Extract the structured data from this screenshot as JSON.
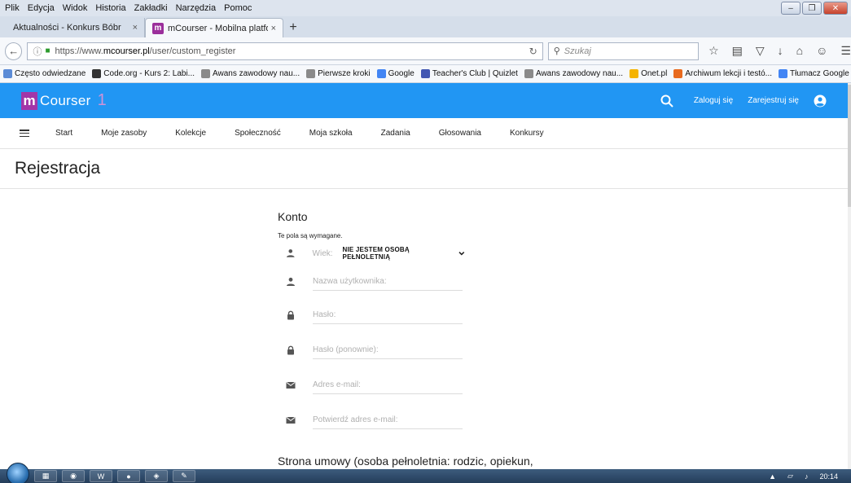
{
  "browser": {
    "menu": [
      "Plik",
      "Edycja",
      "Widok",
      "Historia",
      "Zakładki",
      "Narzędzia",
      "Pomoc"
    ],
    "tabs": [
      {
        "label": "Aktualności - Konkurs Bóbr",
        "close": "×"
      },
      {
        "label": "mCourser - Mobilna platfo...",
        "close": "×",
        "favicon": "m"
      }
    ],
    "new_tab": "+",
    "url_prefix": "https://www.",
    "url_domain": "mcourser.pl",
    "url_path": "/user/custom_register",
    "search_placeholder": "Szukaj",
    "bookmarks": [
      {
        "label": "Często odwiedzane",
        "color": "#5b8bd6"
      },
      {
        "label": "Code.org - Kurs 2: Labi...",
        "color": "#333333"
      },
      {
        "label": "Awans zawodowy nau...",
        "color": "#8a8a8a"
      },
      {
        "label": "Pierwsze kroki",
        "color": "#8a8a8a"
      },
      {
        "label": "Google",
        "color": "#4285f4"
      },
      {
        "label": "Teacher's Club | Quizlet",
        "color": "#4257b2"
      },
      {
        "label": "Awans zawodowy nau...",
        "color": "#8a8a8a"
      },
      {
        "label": "Onet.pl",
        "color": "#f5b400"
      },
      {
        "label": "Archiwum lekcji i testó...",
        "color": "#e86a1e"
      },
      {
        "label": "Tłumacz Google",
        "color": "#4285f4"
      }
    ]
  },
  "site": {
    "logo_m": "m",
    "logo_text": "Courser",
    "logo_suffix": "1",
    "header_color": "#2196f3",
    "login": "Zaloguj się",
    "register": "Zarejestruj się",
    "nav": [
      "Start",
      "Moje zasoby",
      "Kolekcje",
      "Społeczność",
      "Moja szkoła",
      "Zadania",
      "Głosowania",
      "Konkursy"
    ]
  },
  "page": {
    "title": "Rejestracja",
    "section_account": "Konto",
    "required_note": "Te pola są wymagane.",
    "age_label": "Wiek:",
    "age_value": "NIE JESTEM OSOBĄ PEŁNOLETNIĄ",
    "fields": {
      "username": "Nazwa użytkownika:",
      "password": "Hasło:",
      "password_repeat": "Hasło (ponownie):",
      "email": "Adres e-mail:",
      "email_confirm": "Potwierdź adres e-mail:"
    },
    "section_agreement": "Strona umowy (osoba pełnoletnia: rodzic, opiekun,"
  },
  "taskbar": {
    "clock": "20:14"
  }
}
